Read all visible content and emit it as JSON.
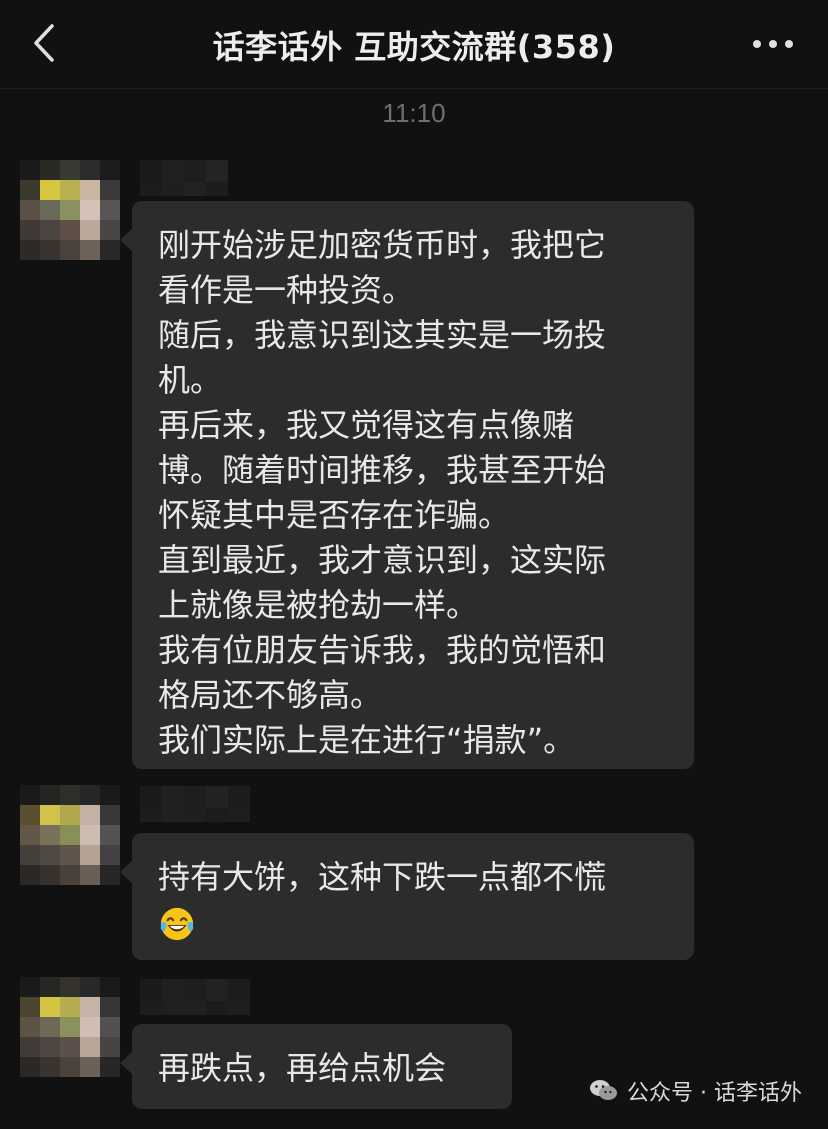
{
  "header": {
    "title": "话李话外 互助交流群(358)",
    "back_icon": "chevron-left-icon",
    "more_icon": "more-dots-icon"
  },
  "chat": {
    "timestamp": "11:10",
    "messages": [
      {
        "lines": [
          "刚开始涉足加密货币时，我把它",
          "看作是一种投资。",
          "随后，我意识到这其实是一场投",
          "机。",
          "再后来，我又觉得这有点像赌",
          "博。随着时间推移，我甚至开始",
          "怀疑其中是否存在诈骗。",
          "直到最近，我才意识到，这实际",
          "上就像是被抢劫一样。",
          "我有位朋友告诉我，我的觉悟和",
          "格局还不够高。",
          "我们实际上是在进行“捐款”。"
        ]
      },
      {
        "lines": [
          "持有大饼，这种下跌一点都不慌"
        ],
        "emoji": "laughing-tears-emoji"
      },
      {
        "lines": [
          "再跌点，再给点机会"
        ]
      }
    ]
  },
  "watermark": {
    "text": "公众号 · 话李话外",
    "icon": "wechat-icon"
  },
  "colors": {
    "background": "#111111",
    "bubble": "#2c2c2c",
    "text": "#e8e8e8",
    "timestamp": "#6f6f6f"
  }
}
